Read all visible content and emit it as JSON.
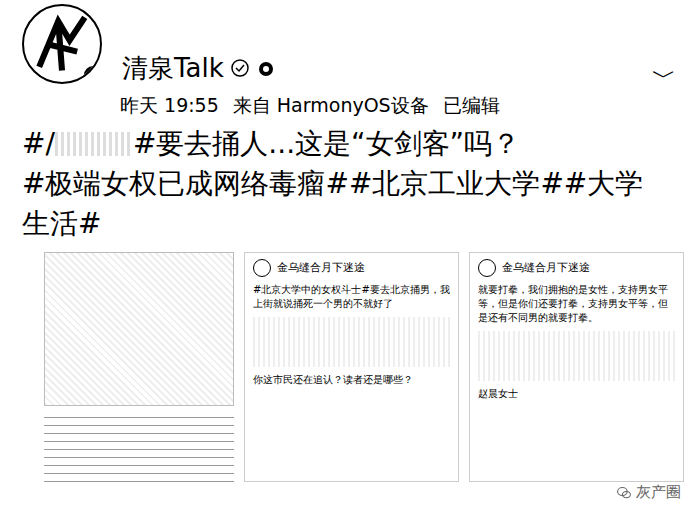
{
  "header": {
    "name": "清泉Talk",
    "time": "昨天 19:55",
    "source": "来自 HarmonyOS设备",
    "edited": "已编辑",
    "menu": "﹀"
  },
  "post": {
    "prefix": "#/",
    "title": "#要去捅人...这是“女剑客”吗？",
    "tags": "#极端女权已成网络毒瘤##北京工业大学##大学生活#"
  },
  "images": [
    {
      "kind": "photo"
    },
    {
      "kind": "screenshot",
      "user": "金乌缝合月下迷途",
      "text": "#北京大学中的女权斗士#要去北京捅男，我上街就说捅死一个男的不就好了",
      "caption": "你这市民还在追认？读者还是哪些？"
    },
    {
      "kind": "screenshot",
      "user": "金乌缝合月下迷途",
      "text": "就要打拳，我们拥抱的是女性，支持男女平等，但是你们还要打拳，支持男女平等，但是还有不同男的就要打拳。",
      "caption": "赵晨女士"
    }
  ],
  "watermark": "灰产圈"
}
